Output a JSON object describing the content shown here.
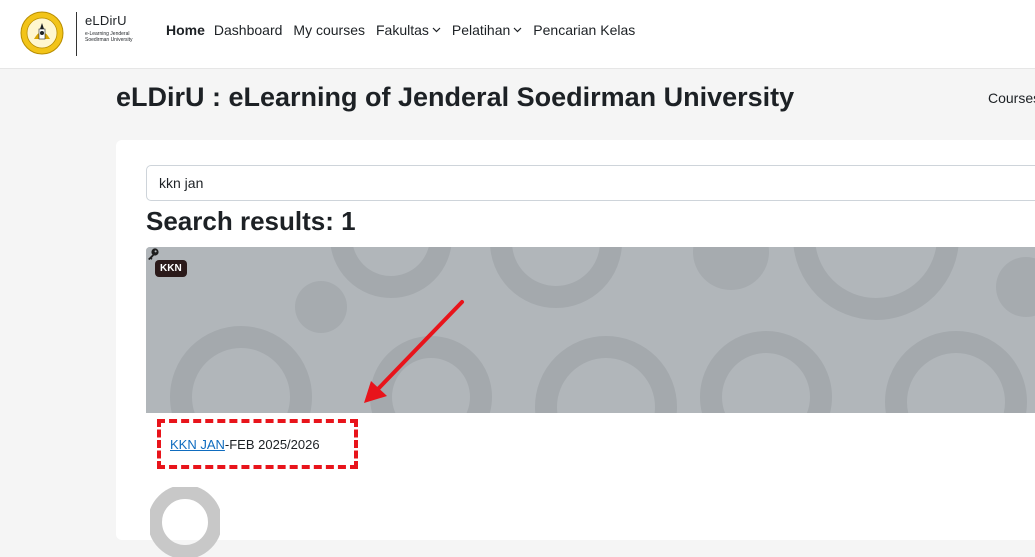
{
  "brand": {
    "name": "eLDirU",
    "sub_line1": "e-Learning Jenderal",
    "sub_line2": "Soedirman University",
    "logo_icon": "university-seal-icon"
  },
  "nav": {
    "items": [
      {
        "label": "Home",
        "active": true
      },
      {
        "label": "Dashboard"
      },
      {
        "label": "My courses"
      },
      {
        "label": "Fakultas",
        "dropdown": true
      },
      {
        "label": "Pelatihan",
        "dropdown": true
      },
      {
        "label": "Pencarian Kelas"
      }
    ]
  },
  "page": {
    "title": "eLDirU : eLearning of Jenderal Soedirman University",
    "header_right": "Courses"
  },
  "search": {
    "value": "kkn jan"
  },
  "results": {
    "heading": "Search results: 1"
  },
  "course": {
    "category_badge": "KKN",
    "name_highlight": "KKN JAN",
    "name_rest": "-FEB 2025/2026",
    "key_icon": "key-icon"
  },
  "colors": {
    "accent": "#0f6cbf",
    "annotation": "#e8141b",
    "card_bg": "#b1b6ba"
  }
}
